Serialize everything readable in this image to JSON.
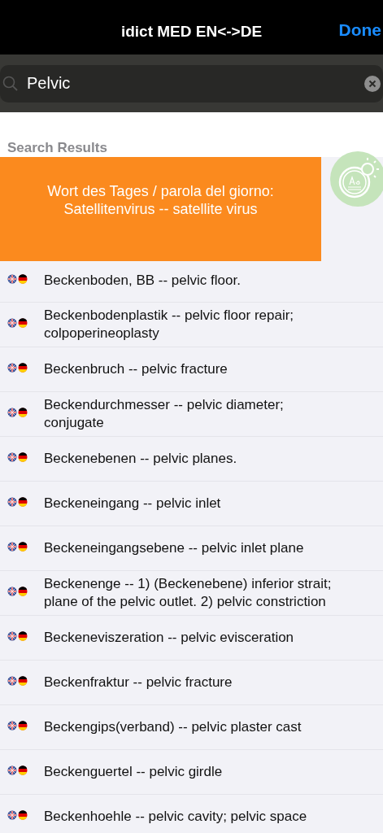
{
  "nav": {
    "title": "idict MED EN<->DE",
    "done": "Done"
  },
  "search": {
    "value": "Pelvic"
  },
  "section": "Search Results",
  "banner": {
    "lines": [
      "Wort des Tages / parola del giorno:",
      "Satellitenvirus -- satellite virus"
    ]
  },
  "results": [
    {
      "text": "Beckenboden, BB -- pelvic floor."
    },
    {
      "text": "Beckenbodenplastik -- pelvic floor repair; colpoperineoplasty"
    },
    {
      "text": "Beckenbruch -- pelvic fracture"
    },
    {
      "text": "Beckendurchmesser -- pelvic diameter; conjugate"
    },
    {
      "text": "Beckenebenen -- pelvic planes."
    },
    {
      "text": "Beckeneingang -- pelvic inlet"
    },
    {
      "text": "Beckeneingangsebene -- pelvic inlet plane"
    },
    {
      "text": "Beckenenge -- 1) (Beckenebene) inferior strait; plane of the pelvic outlet. 2) pelvic constriction"
    },
    {
      "text": "Beckeneviszeration -- pelvic evisceration"
    },
    {
      "text": "Beckenfraktur -- pelvic fracture"
    },
    {
      "text": "Beckengips(verband) -- pelvic plaster cast"
    },
    {
      "text": "Beckenguertel -- pelvic girdle"
    },
    {
      "text": "Beckenhoehle -- pelvic cavity; pelvic space"
    }
  ]
}
